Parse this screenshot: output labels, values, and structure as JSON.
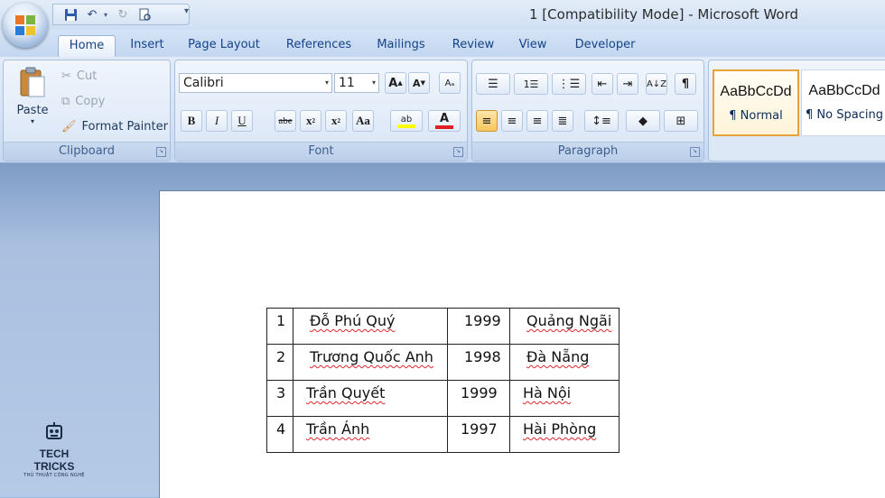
{
  "window": {
    "title": "1 [Compatibility Mode]  -  Microsoft Word"
  },
  "tabs": [
    "Home",
    "Insert",
    "Page Layout",
    "References",
    "Mailings",
    "Review",
    "View",
    "Developer"
  ],
  "active_tab": "Home",
  "clipboard": {
    "paste": "Paste",
    "cut": "Cut",
    "copy": "Copy",
    "format_painter": "Format Painter",
    "label": "Clipboard"
  },
  "font": {
    "name": "Calibri",
    "size": "11",
    "label": "Font"
  },
  "paragraph": {
    "label": "Paragraph"
  },
  "styles": [
    {
      "sample": "AaBbCcDd",
      "name": "¶ Normal"
    },
    {
      "sample": "AaBbCcDd",
      "name": "¶ No Spacing"
    }
  ],
  "table": {
    "rows": [
      [
        "1",
        "Đỗ Phú Quý",
        "1999",
        "Quảng Ngãi"
      ],
      [
        "2",
        "Trương  Quốc Anh",
        "1998",
        "Đà Nẵng"
      ],
      [
        "3",
        "Trần Quyết",
        "1999",
        "Hà Nội"
      ],
      [
        "4",
        "Trần Ánh",
        "1997",
        "Hài Phòng"
      ]
    ]
  },
  "watermark": {
    "title": "TECH TRICKS",
    "subtitle": "THỦ THUẬT CÔNG NGHỆ"
  },
  "colors": {
    "ribbon": "#d4e2f5",
    "workspace": "#a9c0e0",
    "highlight": "#ffff00",
    "font_color": "#e01e24"
  }
}
